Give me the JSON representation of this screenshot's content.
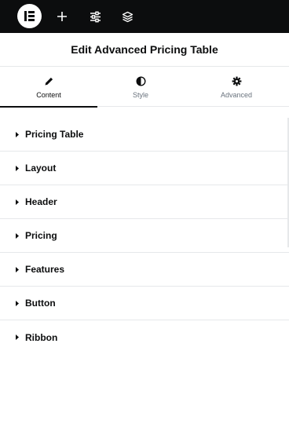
{
  "topbar": {
    "logo_icon": "elementor-logo-icon",
    "buttons": [
      {
        "name": "add-element-button",
        "icon": "plus-icon"
      },
      {
        "name": "site-settings-button",
        "icon": "sliders-icon"
      },
      {
        "name": "structure-button",
        "icon": "layers-icon"
      }
    ]
  },
  "header": {
    "title": "Edit Advanced Pricing Table"
  },
  "tabs": [
    {
      "label": "Content",
      "icon": "pencil-icon",
      "active": true
    },
    {
      "label": "Style",
      "icon": "half-circle-icon",
      "active": false
    },
    {
      "label": "Advanced",
      "icon": "gear-icon",
      "active": false
    }
  ],
  "sections": [
    {
      "label": "Pricing Table"
    },
    {
      "label": "Layout"
    },
    {
      "label": "Header"
    },
    {
      "label": "Pricing"
    },
    {
      "label": "Features"
    },
    {
      "label": "Button"
    },
    {
      "label": "Ribbon"
    }
  ],
  "colors": {
    "topbar_bg": "#0c0d0e",
    "text_primary": "#0c0d0e",
    "text_muted": "#69727d",
    "divider": "#e6e8ea"
  }
}
